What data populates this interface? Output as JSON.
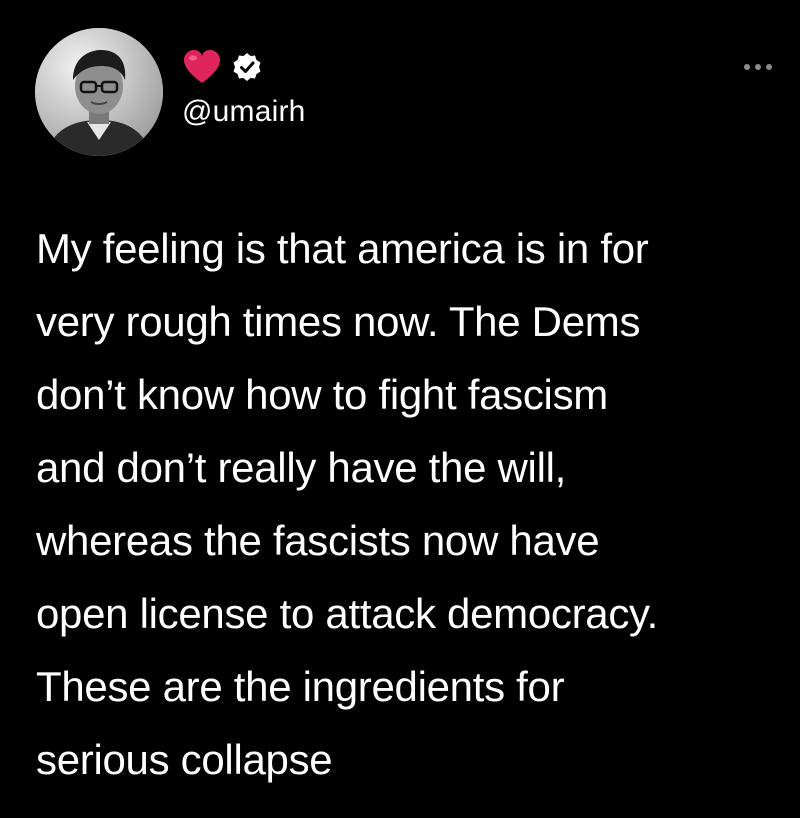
{
  "user": {
    "handle": "@umairh",
    "avatar_icon": "user-avatar-photo",
    "emoji": "red-heart-icon",
    "badge": "verified-badge-icon"
  },
  "menu": {
    "icon": "more-options-icon"
  },
  "tweet": {
    "text": "My feeling is that america is in for\nvery rough times now. The Dems\ndon’t know how to fight fascism\nand don’t really have the will,\nwhereas the fascists now have\nopen license to attack democracy.\nThese are the ingredients for\nserious collapse"
  },
  "colors": {
    "background": "#000000",
    "text": "#ffffff",
    "heart": "#e0245e",
    "muted": "#8b8b8b"
  }
}
